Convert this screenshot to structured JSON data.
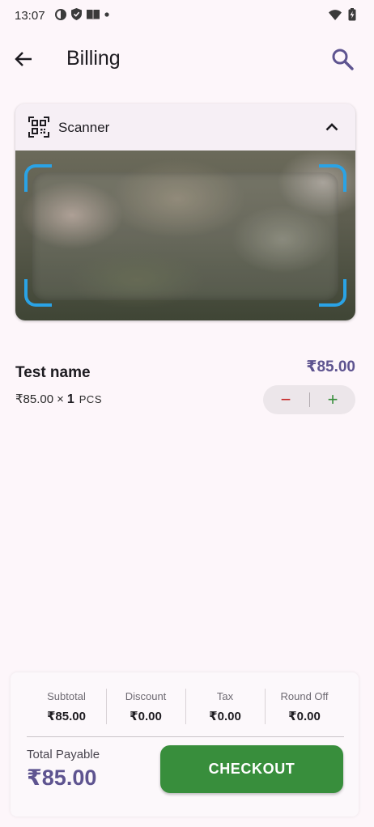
{
  "status_bar": {
    "time": "13:07"
  },
  "app_bar": {
    "title": "Billing",
    "back_icon": "arrow-left-icon",
    "search_icon": "search-icon"
  },
  "scanner": {
    "label": "Scanner",
    "icon": "qr-scan-icon",
    "collapse_icon": "chevron-up-icon",
    "frame_color": "#2aa3e6"
  },
  "cart": {
    "items": [
      {
        "name": "Test name",
        "unit_price": "₹85.00",
        "multiplier": "×",
        "quantity": "1",
        "unit": "PCS",
        "total": "₹85.00",
        "minus": "−",
        "plus": "+"
      }
    ]
  },
  "summary": {
    "cells": [
      {
        "label": "Subtotal",
        "value": "₹85.00"
      },
      {
        "label": "Discount",
        "value": "₹0.00"
      },
      {
        "label": "Tax",
        "value": "₹0.00"
      },
      {
        "label": "Round Off",
        "value": "₹0.00"
      }
    ],
    "total_label": "Total Payable",
    "total_value": "₹85.00",
    "checkout_label": "CHECKOUT"
  },
  "colors": {
    "accent": "#5e5490",
    "checkout": "#388e3c",
    "minus": "#c62828",
    "plus": "#388e3c",
    "background": "#fdf6fa"
  }
}
